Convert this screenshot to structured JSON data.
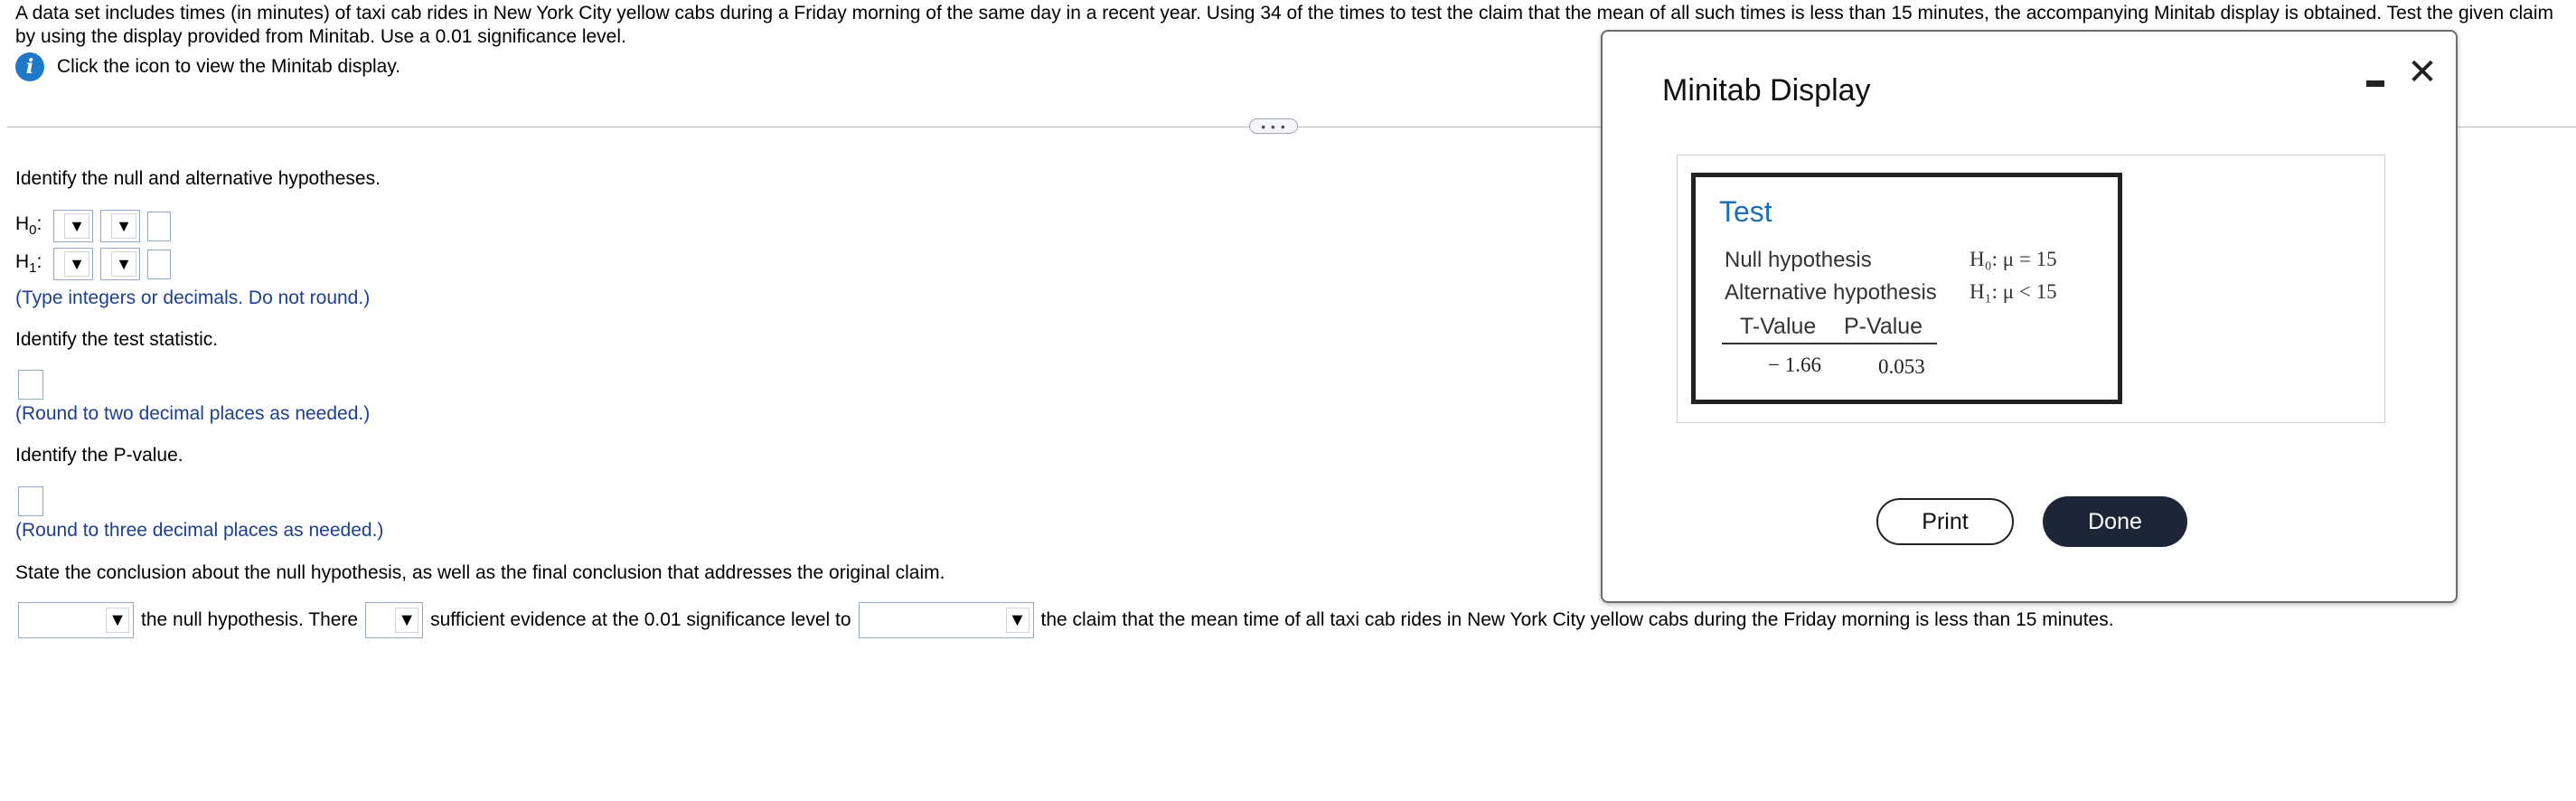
{
  "prompt": {
    "text": "A data set includes times (in minutes) of taxi cab rides in New York City yellow cabs during a Friday morning of the same day in a recent year. Using 34 of the times to test the claim that the mean of all such times is less than 15 minutes, the accompanying Minitab display is obtained. Test the given claim by using the display provided from Minitab. Use a 0.01 significance level."
  },
  "info": {
    "icon": "info-icon",
    "label": "Click the icon to view the Minitab display."
  },
  "expand": {
    "label": "• • •"
  },
  "questions": {
    "hypotheses_prompt": "Identify the null and alternative hypotheses.",
    "h0_label": "H",
    "h0_sub": "0",
    "h1_label": "H",
    "h1_sub": "1",
    "hyp_hint": "(Type integers or decimals. Do not round.)",
    "stat_prompt": "Identify the test statistic.",
    "stat_hint": "(Round to two decimal places as needed.)",
    "pvalue_prompt": "Identify the P-value.",
    "pvalue_hint": "(Round to three decimal places as needed.)",
    "conclusion_prompt": "State the conclusion about the null hypothesis, as well as the final conclusion that addresses the original claim."
  },
  "conclusion": {
    "part1": "the null hypothesis. There",
    "part2": "sufficient evidence at the 0.01 significance level to",
    "part3": "the claim that the mean time of all taxi cab rides in New York City yellow cabs during the Friday morning is less than 15 minutes."
  },
  "modal": {
    "title": "Minitab Display",
    "minimize_icon": "minimize-icon",
    "close_icon": "close-icon",
    "close_glyph": "✕",
    "test_title": "Test",
    "null_label": "Null hypothesis",
    "alt_label": "Alternative hypothesis",
    "null_value": "H₀: μ = 15",
    "alt_value": "H₁: μ < 15",
    "col_t": "T-Value",
    "col_p": "P-Value",
    "t_value": "− 1.66",
    "p_value": "0.053",
    "print_label": "Print",
    "done_label": "Done"
  },
  "colors": {
    "accent_blue": "#1f78c8",
    "hint_blue": "#1d3f8f",
    "minitab_title": "#1a6fb5",
    "done_bg": "#1c2636"
  }
}
